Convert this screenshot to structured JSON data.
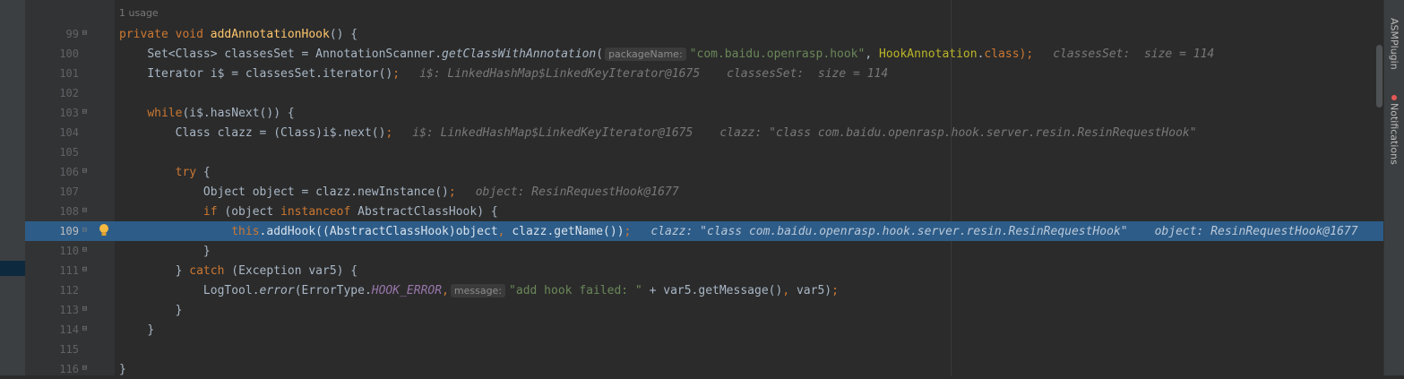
{
  "usage_label": "1 usage",
  "right_tabs": {
    "asm": "ASMPlugin",
    "notifications": "Notifications"
  },
  "lines": {
    "l99": {
      "num": "99",
      "kw": "private void ",
      "fn": "addAnnotationHook",
      "rest": "() {"
    },
    "l100": {
      "num": "100",
      "a": "Set<Class> classesSet = AnnotationScanner.",
      "b": "getClassWithAnnotation",
      "c": "(",
      "hint": "packageName:",
      "str": "\"com.baidu.openrasp.hook\"",
      "d": ", ",
      "e": "HookAnnotation",
      "f": ".",
      "g": "class",
      "h": ");",
      "dbg1": "classesSet:  size = 114"
    },
    "l101": {
      "num": "101",
      "a": "Iterator i$ = classesSet.iterator()",
      "b": ";",
      "dbg1": "i$: LinkedHashMap$LinkedKeyIterator@1675",
      "dbg2": "classesSet:  size = 114"
    },
    "l102": {
      "num": "102"
    },
    "l103": {
      "num": "103",
      "kw": "while",
      "rest": "(i$.hasNext()) {"
    },
    "l104": {
      "num": "104",
      "a": "Class clazz = (Class)i$.next()",
      "b": ";",
      "dbg1": "i$: LinkedHashMap$LinkedKeyIterator@1675",
      "dbg2": "clazz: \"class com.baidu.openrasp.hook.server.resin.ResinRequestHook\""
    },
    "l105": {
      "num": "105"
    },
    "l106": {
      "num": "106",
      "kw": "try",
      "rest": " {"
    },
    "l107": {
      "num": "107",
      "a": "Object object = clazz.newInstance()",
      "b": ";",
      "dbg1": "object: ResinRequestHook@1677"
    },
    "l108": {
      "num": "108",
      "kw": "if",
      "a": " (object ",
      "kw2": "instanceof",
      "b": " AbstractClassHook) {"
    },
    "l109": {
      "num": "109",
      "kw": "this",
      "a": ".addHook((AbstractClassHook)object",
      "b": ", ",
      "c": "clazz.getName())",
      "d": ";",
      "dbg1": "clazz: \"class com.baidu.openrasp.hook.server.resin.ResinRequestHook\"",
      "dbg2": "object: ResinRequestHook@1677"
    },
    "l110": {
      "num": "110",
      "a": "}"
    },
    "l111": {
      "num": "111",
      "a": "} ",
      "kw": "catch",
      "b": " (Exception var5) {"
    },
    "l112": {
      "num": "112",
      "a": "LogTool.",
      "b": "error",
      "c": "(ErrorType.",
      "d": "HOOK_ERROR",
      "e": ",",
      "hint": "message:",
      "str": "\"add hook failed: \"",
      "f": " + var5.getMessage()",
      "g": ", ",
      "h": "var5)",
      "i": ";"
    },
    "l113": {
      "num": "113",
      "a": "}"
    },
    "l114": {
      "num": "114",
      "a": "}"
    },
    "l115": {
      "num": "115"
    },
    "l116": {
      "num": "116",
      "a": "}"
    }
  },
  "colors": {
    "background": "#2b2b2b",
    "gutter": "#313335",
    "execution_line": "#2d5c88",
    "keyword": "#cc7832",
    "method_decl": "#ffc66d",
    "string": "#6a8759",
    "constant": "#9876aa",
    "annotation_class": "#bbb529"
  }
}
